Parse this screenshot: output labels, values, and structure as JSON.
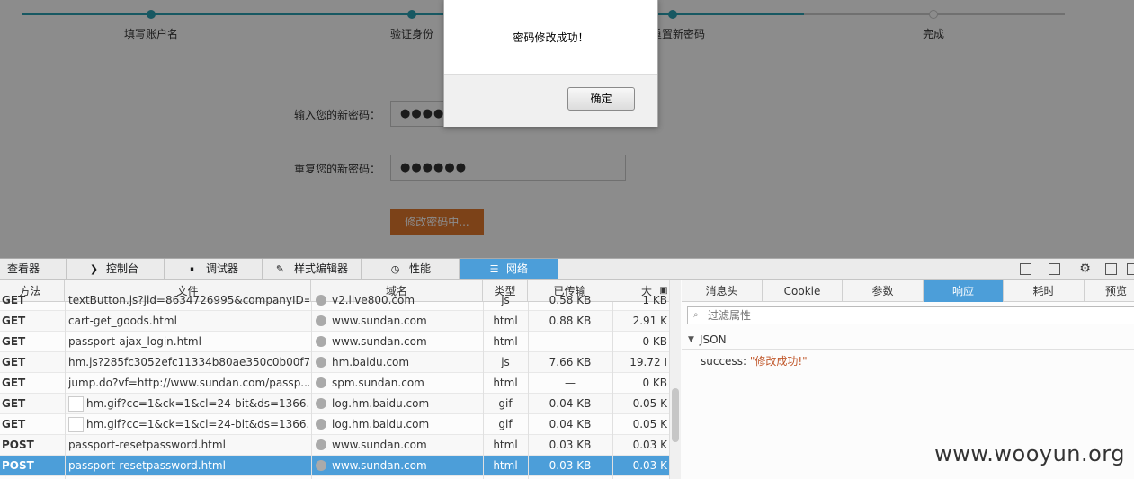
{
  "steps": [
    {
      "label": "填写账户名",
      "state": "done"
    },
    {
      "label": "验证身份",
      "state": "done"
    },
    {
      "label": "重置新密码",
      "state": "current"
    },
    {
      "label": "完成",
      "state": "pending"
    }
  ],
  "form": {
    "new_password_label": "输入您的新密码：",
    "new_password_value": "●●●●●●",
    "repeat_password_label": "重复您的新密码：",
    "repeat_password_value": "●●●●●●",
    "submit_label": "修改密码中..."
  },
  "dialog": {
    "message": "密码修改成功！",
    "ok_label": "确定"
  },
  "devtools": {
    "tabs": [
      {
        "label": "查看器",
        "icon": "inspector-icon"
      },
      {
        "label": "控制台",
        "icon": "console-icon"
      },
      {
        "label": "调试器",
        "icon": "debugger-icon"
      },
      {
        "label": "样式编辑器",
        "icon": "style-editor-icon"
      },
      {
        "label": "性能",
        "icon": "performance-icon"
      },
      {
        "label": "网络",
        "icon": "network-icon",
        "selected": true
      }
    ],
    "columns": {
      "method": "方法",
      "file": "文件",
      "domain": "域名",
      "type": "类型",
      "transferred": "已传输",
      "size": "大"
    },
    "requests": [
      {
        "method": "GET",
        "file": "textButton.js?jid=8634726995&companyID=...",
        "domain": "v2.live800.com",
        "type": "js",
        "transferred": "0.58 KB",
        "size": "1 KB",
        "thumb": false
      },
      {
        "method": "GET",
        "file": "cart-get_goods.html",
        "domain": "www.sundan.com",
        "type": "html",
        "transferred": "0.88 KB",
        "size": "2.91 K",
        "thumb": false
      },
      {
        "method": "GET",
        "file": "passport-ajax_login.html",
        "domain": "www.sundan.com",
        "type": "html",
        "transferred": "—",
        "size": "0 KB",
        "thumb": false
      },
      {
        "method": "GET",
        "file": "hm.js?285fc3052efc11334b80ae350c0b00f7",
        "domain": "hm.baidu.com",
        "type": "js",
        "transferred": "7.66 KB",
        "size": "19.72 I",
        "thumb": false
      },
      {
        "method": "GET",
        "file": "jump.do?vf=http://www.sundan.com/passp...",
        "domain": "spm.sundan.com",
        "type": "html",
        "transferred": "—",
        "size": "0 KB",
        "thumb": false
      },
      {
        "method": "GET",
        "file": "hm.gif?cc=1&ck=1&cl=24-bit&ds=1366...",
        "domain": "log.hm.baidu.com",
        "type": "gif",
        "transferred": "0.04 KB",
        "size": "0.05 K",
        "thumb": true
      },
      {
        "method": "GET",
        "file": "hm.gif?cc=1&ck=1&cl=24-bit&ds=1366...",
        "domain": "log.hm.baidu.com",
        "type": "gif",
        "transferred": "0.04 KB",
        "size": "0.05 K",
        "thumb": true
      },
      {
        "method": "POST",
        "file": "passport-resetpassword.html",
        "domain": "www.sundan.com",
        "type": "html",
        "transferred": "0.03 KB",
        "size": "0.03 K",
        "thumb": false
      },
      {
        "method": "POST",
        "file": "passport-resetpassword.html",
        "domain": "www.sundan.com",
        "type": "html",
        "transferred": "0.03 KB",
        "size": "0.03 K",
        "thumb": false,
        "selected": true
      }
    ],
    "detail_tabs": [
      {
        "label": "消息头"
      },
      {
        "label": "Cookie"
      },
      {
        "label": "参数"
      },
      {
        "label": "响应",
        "selected": true
      },
      {
        "label": "耗时"
      },
      {
        "label": "预览"
      }
    ],
    "filter_placeholder": "过滤属性",
    "json_section": "JSON",
    "json_key": "success:",
    "json_value": "\"修改成功!\""
  },
  "watermark": "www.wooyun.org"
}
